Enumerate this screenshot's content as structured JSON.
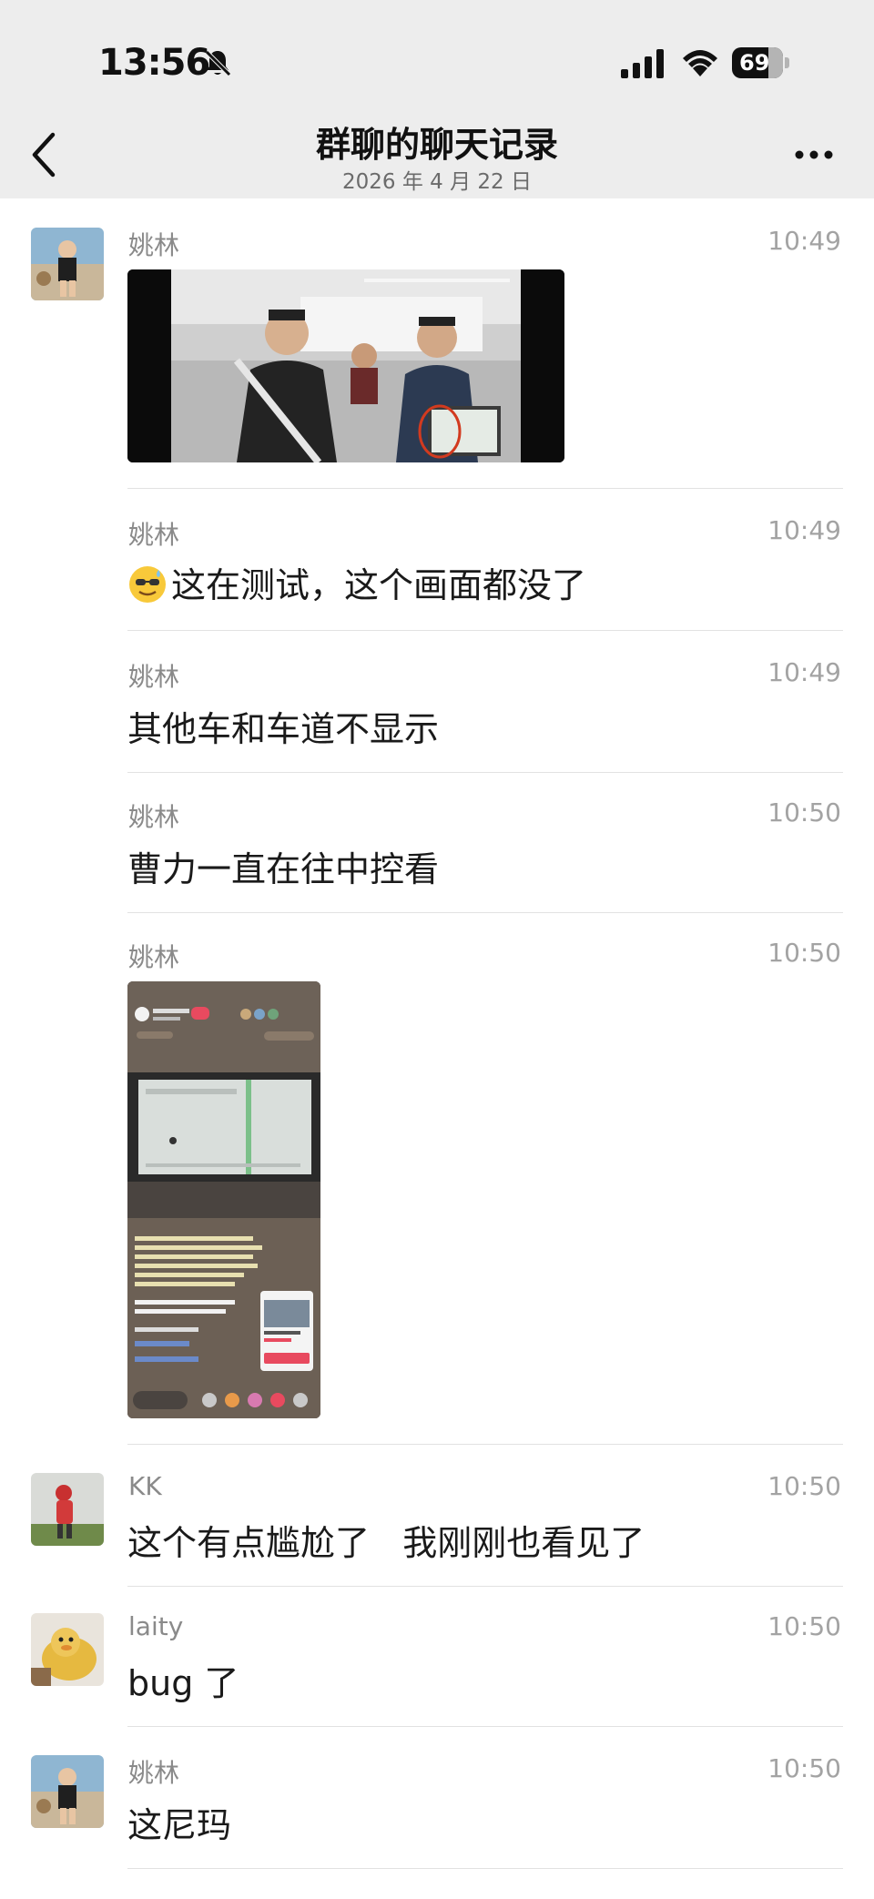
{
  "status_bar": {
    "time": "13:56",
    "battery": "69"
  },
  "nav": {
    "title": "群聊的聊天记录",
    "subtitle": "2026 年 4 月 22 日"
  },
  "messages": [
    {
      "sender": "姚林",
      "time": "10:49",
      "type": "image"
    },
    {
      "sender": "姚林",
      "time": "10:49",
      "text": "这在测试，这个画面都没了"
    },
    {
      "sender": "姚林",
      "time": "10:49",
      "text": "其他车和车道不显示"
    },
    {
      "sender": "姚林",
      "time": "10:50",
      "text": "曹力一直在往中控看"
    },
    {
      "sender": "姚林",
      "time": "10:50",
      "type": "image"
    },
    {
      "sender": "KK",
      "time": "10:50",
      "text": "这个有点尴尬了   我刚刚也看见了"
    },
    {
      "sender": "laity",
      "time": "10:50",
      "text": "bug 了"
    },
    {
      "sender": "姚林",
      "time": "10:50",
      "text": "这尼玛"
    }
  ],
  "colors": {
    "header_bg": "#ededed",
    "sender": "#8a8a8a",
    "time": "#a3a3a3",
    "text": "#1a1a1a"
  }
}
